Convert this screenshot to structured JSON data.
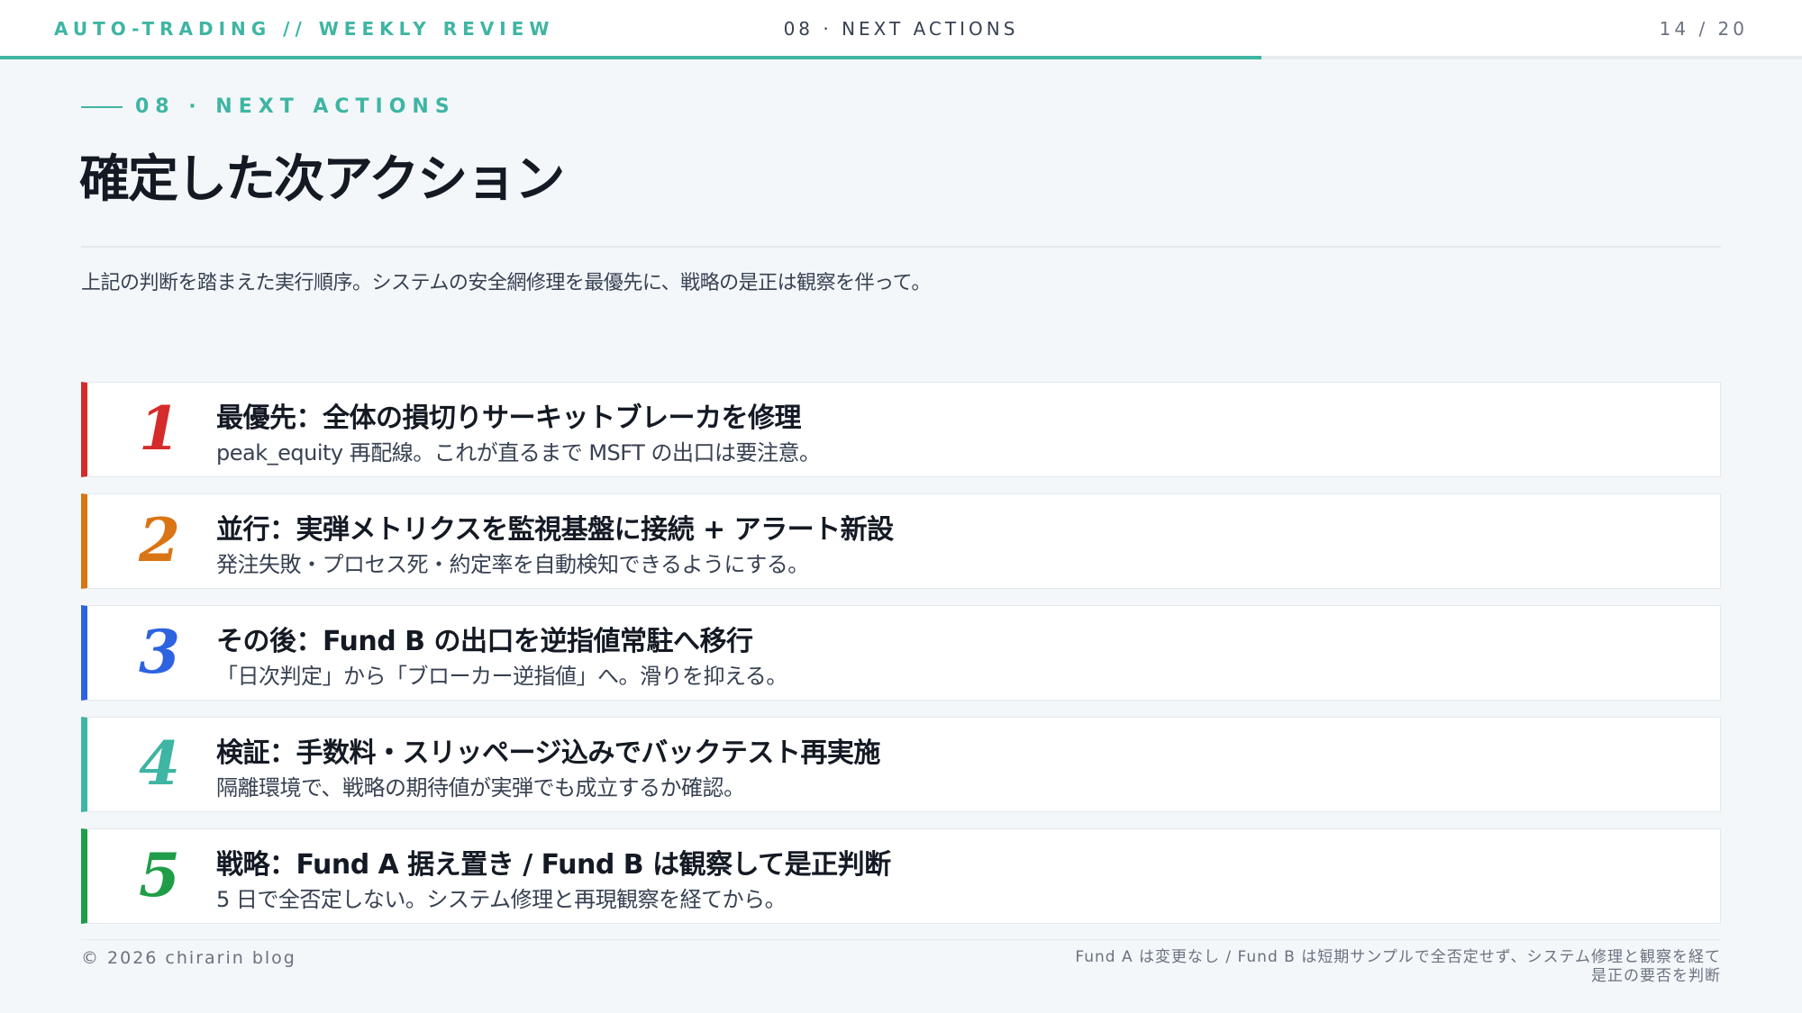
{
  "header": {
    "brand": "AUTO-TRADING // WEEKLY REVIEW",
    "section": "08 · NEXT ACTIONS",
    "page": "14 / 20",
    "progress": 0.7
  },
  "eyebrow": "08 · NEXT ACTIONS",
  "title": "確定した次アクション",
  "lead": "上記の判断を踏まえた実行順序。システムの安全網修理を最優先に、戦略の是正は観察を伴って。",
  "actions": [
    {
      "number": "1",
      "color": "#d62b2b",
      "title": "最優先：全体の損切りサーキットブレーカを修理",
      "desc": "peak_equity 再配線。これが直るまで MSFT の出口は要注意。"
    },
    {
      "number": "2",
      "color": "#d97514",
      "title": "並行：実弾メトリクスを監視基盤に接続 + アラート新設",
      "desc": "発注失敗・プロセス死・約定率を自動検知できるようにする。"
    },
    {
      "number": "3",
      "color": "#2e63e0",
      "title": "その後：Fund B の出口を逆指値常駐へ移行",
      "desc": "「日次判定」から「ブローカー逆指値」へ。滑りを抑える。"
    },
    {
      "number": "4",
      "color": "#3fb5a3",
      "title": "検証：手数料・スリッページ込みでバックテスト再実施",
      "desc": "隔離環境で、戦略の期待値が実弾でも成立するか確認。"
    },
    {
      "number": "5",
      "color": "#1f9d48",
      "title": "戦略：Fund A 据え置き / Fund B は観察して是正判断",
      "desc": "5 日で全否定しない。システム修理と再現観察を経てから。"
    }
  ],
  "footer": {
    "copyright": "© 2026 chirarin blog",
    "note_line1": "Fund A は変更なし / Fund B は短期サンプルで全否定せず、システム修理と観察を経て",
    "note_line2": "是正の要否を判断"
  }
}
